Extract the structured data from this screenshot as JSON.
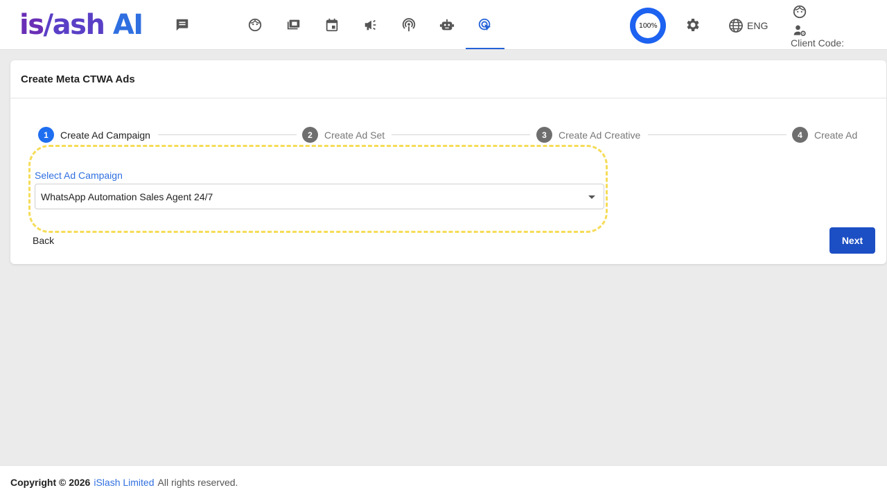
{
  "header": {
    "logo": {
      "part1": "is",
      "part2": "/ash",
      "part3": " AI"
    },
    "progress_label": "100%",
    "language": "ENG",
    "client_code_label": "Client Code:",
    "nav_icons": [
      "chat-icon",
      "face-icon",
      "payments-icon",
      "calendar-icon",
      "campaign-icon",
      "podcast-icon",
      "robot-icon",
      "ads-click-icon"
    ],
    "active_nav": "ads-click-icon",
    "accent_color": "#2563d8"
  },
  "card": {
    "title": "Create Meta CTWA Ads",
    "steps": [
      {
        "number": "1",
        "label": "Create Ad Campaign",
        "active": true
      },
      {
        "number": "2",
        "label": "Create Ad Set",
        "active": false
      },
      {
        "number": "3",
        "label": "Create Ad Creative",
        "active": false
      },
      {
        "number": "4",
        "label": "Create Ad",
        "active": false
      }
    ],
    "select_label": "Select Ad Campaign",
    "select_value": "WhatsApp Automation Sales Agent 24/7",
    "back_label": "Back",
    "next_label": "Next"
  },
  "footer": {
    "copyright": "Copyright © 2026",
    "company": "iSlash Limited",
    "rights": "All rights reserved."
  }
}
